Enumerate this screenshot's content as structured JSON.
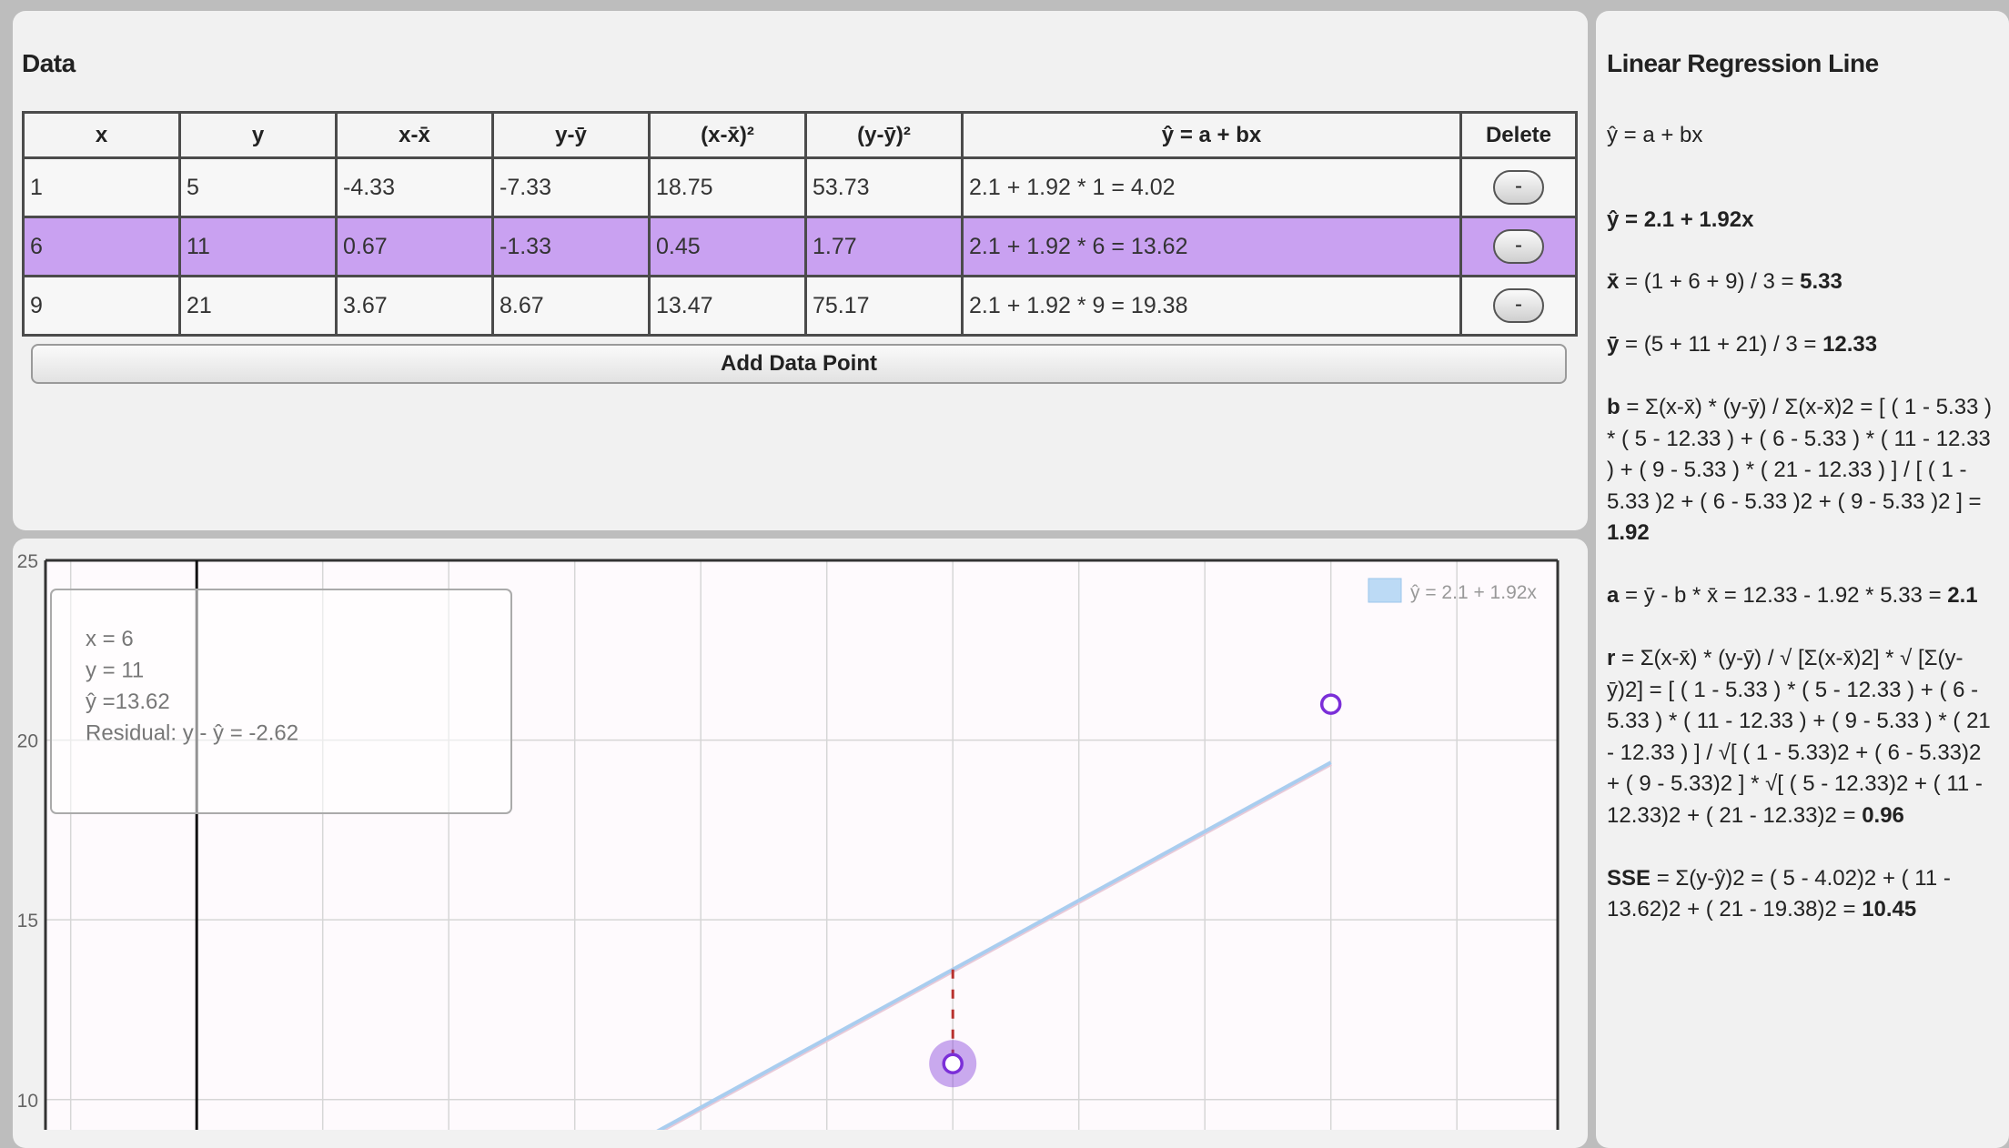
{
  "data_panel": {
    "title": "Data",
    "columns": [
      "x",
      "y",
      "x-x̄",
      "y-ȳ",
      "(x-x̄)²",
      "(y-ȳ)²",
      "ŷ = a + bx",
      "Delete"
    ],
    "rows": [
      {
        "x": "1",
        "y": "5",
        "dx": "-4.33",
        "dy": "-7.33",
        "dx2": "18.75",
        "dy2": "53.73",
        "yhat": "2.1 + 1.92 * 1 = 4.02",
        "delete": "-",
        "selected": false
      },
      {
        "x": "6",
        "y": "11",
        "dx": "0.67",
        "dy": "-1.33",
        "dx2": "0.45",
        "dy2": "1.77",
        "yhat": "2.1 + 1.92 * 6 = 13.62",
        "delete": "-",
        "selected": true
      },
      {
        "x": "9",
        "y": "21",
        "dx": "3.67",
        "dy": "8.67",
        "dx2": "13.47",
        "dy2": "75.17",
        "yhat": "2.1 + 1.92 * 9 = 19.38",
        "delete": "-",
        "selected": false
      }
    ],
    "add_button": "Add Data Point"
  },
  "side_panel": {
    "title": "Linear Regression Line",
    "formula": "ŷ = a + bx",
    "equation": "ŷ = 2.1 + 1.92x",
    "xbar": {
      "label": "x̄",
      "expr": " = (1 + 6 + 9) / 3 = ",
      "result": "5.33"
    },
    "ybar": {
      "label": "ȳ",
      "expr": " = (5 + 11 + 21) / 3 = ",
      "result": "12.33"
    },
    "b": {
      "label": "b",
      "expr": " = Σ(x-x̄) * (y-ȳ) / Σ(x-x̄)2 = [ ( 1 - 5.33 ) * ( 5 - 12.33 ) + ( 6 - 5.33 ) * ( 11 - 12.33 ) + ( 9 - 5.33 ) * ( 21 - 12.33 ) ] / [ ( 1 - 5.33 )2 + ( 6 - 5.33 )2 + ( 9 - 5.33 )2 ] = ",
      "result": "1.92"
    },
    "a": {
      "label": "a",
      "expr": " = ȳ - b * x̄ = 12.33 - 1.92 * 5.33 = ",
      "result": "2.1"
    },
    "r": {
      "label": "r",
      "expr": " = Σ(x-x̄) * (y-ȳ) / √ [Σ(x-x̄)2] * √ [Σ(y-ȳ)2] = [ ( 1 - 5.33 ) * ( 5 - 12.33 ) + ( 6 - 5.33 ) * ( 11 - 12.33 ) + ( 9 - 5.33 ) * ( 21 - 12.33 ) ] / √[ ( 1 - 5.33)2 + ( 6 - 5.33)2 + ( 9 - 5.33)2 ] * √[ ( 5 - 12.33)2 + ( 11 - 12.33)2 + ( 21 - 12.33)2 = ",
      "result": "0.96"
    },
    "sse": {
      "label": "SSE",
      "expr": " = Σ(y-ŷ)2 = ( 5 - 4.02)2 + ( 11 - 13.62)2 + ( 21 - 19.38)2 = ",
      "result": "10.45"
    }
  },
  "chart_data": {
    "type": "scatter",
    "xlim": [
      -1.2,
      10.8
    ],
    "ylim": [
      8.4,
      25
    ],
    "y_ticks": [
      10,
      15,
      20,
      25
    ],
    "x_gridlines": [
      -1,
      0,
      1,
      2,
      3,
      4,
      5,
      6,
      7,
      8,
      9,
      10
    ],
    "grid": true,
    "series": [
      {
        "name": "ŷ = 2.1 + 1.92x",
        "type": "line",
        "x": [
          3,
          9
        ],
        "y": [
          7.86,
          19.38
        ]
      }
    ],
    "points": [
      {
        "x": 6,
        "y": 11,
        "selected": true
      },
      {
        "x": 9,
        "y": 21,
        "selected": false
      }
    ],
    "residual": {
      "x": 6,
      "from_y": 11,
      "to_y": 13.62
    },
    "legend_position": "top-right",
    "colors": {
      "line": "#a9cdef",
      "point": "#7b2fd8",
      "residual": "#b8322e",
      "axis": "#111111"
    },
    "tooltip": {
      "lines": [
        "x = 6",
        "y = 11",
        "ŷ =13.62",
        "Residual: y - ŷ = -2.62"
      ]
    }
  }
}
